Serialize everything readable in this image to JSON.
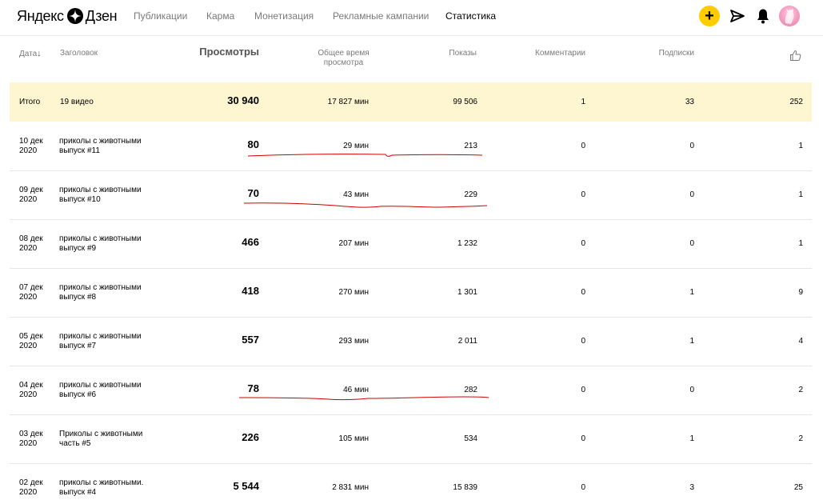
{
  "brand": {
    "logo_left": "Яндекс",
    "logo_right": "Дзен"
  },
  "nav": [
    {
      "label": "Публикации"
    },
    {
      "label": "Карма"
    },
    {
      "label": "Монетизация"
    },
    {
      "label": "Рекламные кампании"
    },
    {
      "label": "Статистика",
      "active": true
    }
  ],
  "header_actions": {
    "add": "+",
    "icons": [
      "add-icon",
      "send-icon",
      "bell-icon",
      "avatar"
    ]
  },
  "columns": {
    "date": "Дата",
    "sort_arrow": "↓",
    "title": "Заголовок",
    "views": "Просмотры",
    "watch_time": "Общее время просмотра",
    "impressions": "Показы",
    "comments": "Комментарии",
    "subscriptions": "Подписки",
    "likes_icon": "thumbs-up-icon"
  },
  "totals": {
    "label": "Итого",
    "title": "19 видео",
    "views": "30 940",
    "watch_time": "17 827 мин",
    "impressions": "99 506",
    "comments": "1",
    "subscriptions": "33",
    "likes": "252"
  },
  "rows": [
    {
      "date1": "10 дек",
      "date2": "2020",
      "title1": "приколы с животными",
      "title2": "выпуск #11",
      "views": "80",
      "watch_time": "29 мин",
      "impressions": "213",
      "comments": "0",
      "subscriptions": "0",
      "likes": "1"
    },
    {
      "date1": "09 дек",
      "date2": "2020",
      "title1": "приколы с животными",
      "title2": "выпуск #10",
      "views": "70",
      "watch_time": "43 мин",
      "impressions": "229",
      "comments": "0",
      "subscriptions": "0",
      "likes": "1"
    },
    {
      "date1": "08 дек",
      "date2": "2020",
      "title1": "приколы с животными",
      "title2": "выпуск #9",
      "views": "466",
      "watch_time": "207 мин",
      "impressions": "1 232",
      "comments": "0",
      "subscriptions": "0",
      "likes": "1"
    },
    {
      "date1": "07 дек",
      "date2": "2020",
      "title1": "приколы с животными",
      "title2": "выпуск #8",
      "views": "418",
      "watch_time": "270 мин",
      "impressions": "1 301",
      "comments": "0",
      "subscriptions": "1",
      "likes": "9"
    },
    {
      "date1": "05 дек",
      "date2": "2020",
      "title1": "приколы с животными",
      "title2": "выпуск #7",
      "views": "557",
      "watch_time": "293 мин",
      "impressions": "2 011",
      "comments": "0",
      "subscriptions": "1",
      "likes": "4"
    },
    {
      "date1": "04 дек",
      "date2": "2020",
      "title1": "приколы с животными",
      "title2": "выпуск #6",
      "views": "78",
      "watch_time": "46 мин",
      "impressions": "282",
      "comments": "0",
      "subscriptions": "0",
      "likes": "2"
    },
    {
      "date1": "03 дек",
      "date2": "2020",
      "title1": "Приколы с животными",
      "title2": "часть #5",
      "views": "226",
      "watch_time": "105 мин",
      "impressions": "534",
      "comments": "0",
      "subscriptions": "1",
      "likes": "2"
    },
    {
      "date1": "02 дек",
      "date2": "2020",
      "title1": "приколы с животными.",
      "title2": "выпуск #4",
      "views": "5 544",
      "watch_time": "2 831 мин",
      "impressions": "15 839",
      "comments": "0",
      "subscriptions": "3",
      "likes": "25"
    }
  ],
  "colors": {
    "total_bg": "#fdf6d0",
    "add_button": "#ffcc00",
    "annotation": "#cc0000"
  }
}
